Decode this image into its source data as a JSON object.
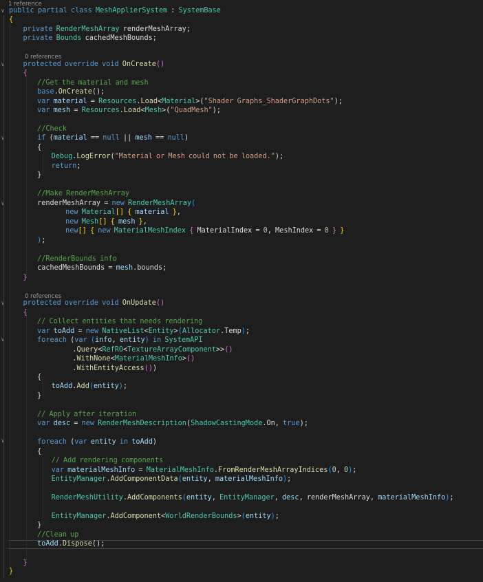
{
  "editor": {
    "theme_colors": {
      "background": "#1e1e1e",
      "keyword": "#569cd6",
      "type": "#4ec9b0",
      "string": "#d69d85",
      "comment": "#57a64a",
      "number": "#b5cea8",
      "method": "#dcdcaa",
      "local": "#9cdcfe",
      "default": "#dcdcdc",
      "brace_lvl1": "#ffd700",
      "brace_lvl2": "#da70d6",
      "brace_lvl3": "#179fff",
      "codelens": "#999999"
    },
    "codelens": {
      "class_refs": "1 reference",
      "oncreate_refs": "0 references",
      "onupdate_refs": "0 references"
    },
    "lines": [
      [
        [
          "kw",
          "public"
        ],
        [
          "d",
          " "
        ],
        [
          "kw",
          "partial"
        ],
        [
          "d",
          " "
        ],
        [
          "kw",
          "class"
        ],
        [
          "d",
          " "
        ],
        [
          "ty",
          "MeshApplierSystem"
        ],
        [
          "d",
          " : "
        ],
        [
          "ty",
          "SystemBase"
        ]
      ],
      [
        [
          "b1",
          "{"
        ]
      ],
      [
        [
          "d",
          "    "
        ],
        [
          "kw",
          "private"
        ],
        [
          "d",
          " "
        ],
        [
          "ty",
          "RenderMeshArray"
        ],
        [
          "d",
          " renderMeshArray;"
        ]
      ],
      [
        [
          "d",
          "    "
        ],
        [
          "kw",
          "private"
        ],
        [
          "d",
          " "
        ],
        [
          "ty",
          "Bounds"
        ],
        [
          "d",
          " cachedMeshBounds;"
        ]
      ],
      [],
      [
        [
          "d",
          "    "
        ],
        [
          "kw",
          "protected"
        ],
        [
          "d",
          " "
        ],
        [
          "kw",
          "override"
        ],
        [
          "d",
          " "
        ],
        [
          "kw",
          "void"
        ],
        [
          "d",
          " "
        ],
        [
          "fn",
          "OnCreate"
        ],
        [
          "b2",
          "()"
        ]
      ],
      [
        [
          "d",
          "    "
        ],
        [
          "b2",
          "{"
        ]
      ],
      [
        [
          "d",
          "        "
        ],
        [
          "cm",
          "//Get the material and mesh"
        ]
      ],
      [
        [
          "d",
          "        "
        ],
        [
          "kw",
          "base"
        ],
        [
          "d",
          "."
        ],
        [
          "fn",
          "OnCreate"
        ],
        [
          "d",
          "();"
        ]
      ],
      [
        [
          "d",
          "        "
        ],
        [
          "kw",
          "var"
        ],
        [
          "d",
          " "
        ],
        [
          "lv",
          "material"
        ],
        [
          "d",
          " = "
        ],
        [
          "ty",
          "Resources"
        ],
        [
          "d",
          "."
        ],
        [
          "fn",
          "Load"
        ],
        [
          "d",
          "<"
        ],
        [
          "ty",
          "Material"
        ],
        [
          "d",
          ">("
        ],
        [
          "st",
          "\"Shader Graphs_ShaderGraphDots\""
        ],
        [
          "d",
          ");"
        ]
      ],
      [
        [
          "d",
          "        "
        ],
        [
          "kw",
          "var"
        ],
        [
          "d",
          " "
        ],
        [
          "lv",
          "mesh"
        ],
        [
          "d",
          " = "
        ],
        [
          "ty",
          "Resources"
        ],
        [
          "d",
          "."
        ],
        [
          "fn",
          "Load"
        ],
        [
          "d",
          "<"
        ],
        [
          "ty",
          "Mesh"
        ],
        [
          "d",
          ">("
        ],
        [
          "st",
          "\"QuadMesh\""
        ],
        [
          "d",
          ");"
        ]
      ],
      [],
      [
        [
          "d",
          "        "
        ],
        [
          "cm",
          "//Check"
        ]
      ],
      [
        [
          "d",
          "        "
        ],
        [
          "kw",
          "if"
        ],
        [
          "d",
          " ("
        ],
        [
          "lv",
          "material"
        ],
        [
          "d",
          " == "
        ],
        [
          "kw",
          "null"
        ],
        [
          "d",
          " || "
        ],
        [
          "lv",
          "mesh"
        ],
        [
          "d",
          " == "
        ],
        [
          "kw",
          "null"
        ],
        [
          "d",
          ")"
        ]
      ],
      [
        [
          "d",
          "        {"
        ]
      ],
      [
        [
          "d",
          "            "
        ],
        [
          "ty",
          "Debug"
        ],
        [
          "d",
          "."
        ],
        [
          "fn",
          "LogError"
        ],
        [
          "d",
          "("
        ],
        [
          "st",
          "\"Material or Mesh could not be loaded.\""
        ],
        [
          "d",
          ");"
        ]
      ],
      [
        [
          "d",
          "            "
        ],
        [
          "kw",
          "return"
        ],
        [
          "d",
          ";"
        ]
      ],
      [
        [
          "d",
          "        }"
        ]
      ],
      [],
      [
        [
          "d",
          "        "
        ],
        [
          "cm",
          "//Make RenderMeshArray"
        ]
      ],
      [
        [
          "d",
          "        renderMeshArray = "
        ],
        [
          "kw",
          "new"
        ],
        [
          "d",
          " "
        ],
        [
          "ty",
          "RenderMeshArray"
        ],
        [
          "b3",
          "("
        ]
      ],
      [
        [
          "d",
          "                "
        ],
        [
          "kw",
          "new"
        ],
        [
          "d",
          " "
        ],
        [
          "ty",
          "Material"
        ],
        [
          "b1",
          "[]"
        ],
        [
          "d",
          " "
        ],
        [
          "b1",
          "{"
        ],
        [
          "d",
          " "
        ],
        [
          "lv",
          "material"
        ],
        [
          "d",
          " "
        ],
        [
          "b1",
          "}"
        ],
        [
          "d",
          ","
        ]
      ],
      [
        [
          "d",
          "                "
        ],
        [
          "kw",
          "new"
        ],
        [
          "d",
          " "
        ],
        [
          "ty",
          "Mesh"
        ],
        [
          "b1",
          "[]"
        ],
        [
          "d",
          " "
        ],
        [
          "b1",
          "{"
        ],
        [
          "d",
          " "
        ],
        [
          "lv",
          "mesh"
        ],
        [
          "d",
          " "
        ],
        [
          "b1",
          "}"
        ],
        [
          "d",
          ","
        ]
      ],
      [
        [
          "d",
          "                "
        ],
        [
          "kw",
          "new"
        ],
        [
          "b1",
          "[]"
        ],
        [
          "d",
          " "
        ],
        [
          "b1",
          "{"
        ],
        [
          "d",
          " "
        ],
        [
          "kw",
          "new"
        ],
        [
          "d",
          " "
        ],
        [
          "ty",
          "MaterialMeshIndex"
        ],
        [
          "d",
          " "
        ],
        [
          "b2",
          "{"
        ],
        [
          "d",
          " MaterialIndex = "
        ],
        [
          "nm",
          "0"
        ],
        [
          "d",
          ", MeshIndex = "
        ],
        [
          "nm",
          "0"
        ],
        [
          "d",
          " "
        ],
        [
          "b2",
          "}"
        ],
        [
          "d",
          " "
        ],
        [
          "b1",
          "}"
        ]
      ],
      [
        [
          "d",
          "        "
        ],
        [
          "b3",
          ")"
        ],
        [
          "d",
          ";"
        ]
      ],
      [],
      [
        [
          "d",
          "        "
        ],
        [
          "cm",
          "//RenderBounds info"
        ]
      ],
      [
        [
          "d",
          "        cachedMeshBounds = "
        ],
        [
          "lv",
          "mesh"
        ],
        [
          "d",
          "."
        ],
        [
          "d",
          "bounds;"
        ]
      ],
      [
        [
          "d",
          "    "
        ],
        [
          "b2",
          "}"
        ]
      ],
      [],
      [
        [
          "d",
          "    "
        ],
        [
          "kw",
          "protected"
        ],
        [
          "d",
          " "
        ],
        [
          "kw",
          "override"
        ],
        [
          "d",
          " "
        ],
        [
          "kw",
          "void"
        ],
        [
          "d",
          " "
        ],
        [
          "fn",
          "OnUpdate"
        ],
        [
          "b2",
          "()"
        ]
      ],
      [
        [
          "d",
          "    "
        ],
        [
          "b2",
          "{"
        ]
      ],
      [
        [
          "d",
          "        "
        ],
        [
          "cm",
          "// Collect entities that needs rendering"
        ]
      ],
      [
        [
          "d",
          "        "
        ],
        [
          "kw",
          "var"
        ],
        [
          "d",
          " "
        ],
        [
          "lv",
          "toAdd"
        ],
        [
          "d",
          " = "
        ],
        [
          "kw",
          "new"
        ],
        [
          "d",
          " "
        ],
        [
          "ty",
          "NativeList"
        ],
        [
          "d",
          "<"
        ],
        [
          "ty",
          "Entity"
        ],
        [
          "d",
          ">"
        ],
        [
          "b3",
          "("
        ],
        [
          "ty",
          "Allocator"
        ],
        [
          "d",
          ".Temp"
        ],
        [
          "b3",
          ")"
        ],
        [
          "d",
          ";"
        ]
      ],
      [
        [
          "d",
          "        "
        ],
        [
          "kw",
          "foreach"
        ],
        [
          "d",
          " ("
        ],
        [
          "kw",
          "var"
        ],
        [
          "d",
          " "
        ],
        [
          "b3",
          "("
        ],
        [
          "lv",
          "info"
        ],
        [
          "d",
          ", "
        ],
        [
          "lv",
          "entity"
        ],
        [
          "b3",
          ")"
        ],
        [
          "d",
          " "
        ],
        [
          "kw",
          "in"
        ],
        [
          "d",
          " "
        ],
        [
          "ty",
          "SystemAPI"
        ]
      ],
      [
        [
          "d",
          "                  ."
        ],
        [
          "fn",
          "Query"
        ],
        [
          "d",
          "<"
        ],
        [
          "ty",
          "RefRO"
        ],
        [
          "d",
          "<"
        ],
        [
          "ty",
          "TextureArrayComponent"
        ],
        [
          "d",
          ">>"
        ],
        [
          "b2",
          "()"
        ]
      ],
      [
        [
          "d",
          "                  ."
        ],
        [
          "fn",
          "WithNone"
        ],
        [
          "d",
          "<"
        ],
        [
          "ty",
          "MaterialMeshInfo"
        ],
        [
          "d",
          ">"
        ],
        [
          "b2",
          "()"
        ]
      ],
      [
        [
          "d",
          "                  ."
        ],
        [
          "fn",
          "WithEntityAccess"
        ],
        [
          "b2",
          "()"
        ],
        [
          "d",
          ")"
        ]
      ],
      [
        [
          "d",
          "        {"
        ]
      ],
      [
        [
          "d",
          "            "
        ],
        [
          "lv",
          "toAdd"
        ],
        [
          "d",
          "."
        ],
        [
          "fn",
          "Add"
        ],
        [
          "b3",
          "("
        ],
        [
          "lv",
          "entity"
        ],
        [
          "b3",
          ")"
        ],
        [
          "d",
          ";"
        ]
      ],
      [
        [
          "d",
          "        }"
        ]
      ],
      [],
      [
        [
          "d",
          "        "
        ],
        [
          "cm",
          "// Apply after iteration"
        ]
      ],
      [
        [
          "d",
          "        "
        ],
        [
          "kw",
          "var"
        ],
        [
          "d",
          " "
        ],
        [
          "lv",
          "desc"
        ],
        [
          "d",
          " = "
        ],
        [
          "kw",
          "new"
        ],
        [
          "d",
          " "
        ],
        [
          "ty",
          "RenderMeshDescription"
        ],
        [
          "d",
          "("
        ],
        [
          "ty",
          "ShadowCastingMode"
        ],
        [
          "d",
          ".On, "
        ],
        [
          "kw",
          "true"
        ],
        [
          "d",
          ");"
        ]
      ],
      [],
      [
        [
          "d",
          "        "
        ],
        [
          "kw",
          "foreach"
        ],
        [
          "d",
          " ("
        ],
        [
          "kw",
          "var"
        ],
        [
          "d",
          " "
        ],
        [
          "lv",
          "entity"
        ],
        [
          "d",
          " "
        ],
        [
          "kw",
          "in"
        ],
        [
          "d",
          " "
        ],
        [
          "lv",
          "toAdd"
        ],
        [
          "d",
          ")"
        ]
      ],
      [
        [
          "d",
          "        {"
        ]
      ],
      [
        [
          "d",
          "            "
        ],
        [
          "cm",
          "// Add rendering components"
        ]
      ],
      [
        [
          "d",
          "            "
        ],
        [
          "kw",
          "var"
        ],
        [
          "d",
          " "
        ],
        [
          "lv",
          "materialMeshInfo"
        ],
        [
          "d",
          " = "
        ],
        [
          "ty",
          "MaterialMeshInfo"
        ],
        [
          "d",
          "."
        ],
        [
          "fn",
          "FromRenderMeshArrayIndices"
        ],
        [
          "b3",
          "("
        ],
        [
          "nm",
          "0"
        ],
        [
          "d",
          ", "
        ],
        [
          "nm",
          "0"
        ],
        [
          "b3",
          ")"
        ],
        [
          "d",
          ";"
        ]
      ],
      [
        [
          "d",
          "            "
        ],
        [
          "ty",
          "EntityManager"
        ],
        [
          "d",
          "."
        ],
        [
          "fn",
          "AddComponentData"
        ],
        [
          "b3",
          "("
        ],
        [
          "lv",
          "entity"
        ],
        [
          "d",
          ", "
        ],
        [
          "lv",
          "materialMeshInfo"
        ],
        [
          "b3",
          ")"
        ],
        [
          "d",
          ";"
        ]
      ],
      [],
      [
        [
          "d",
          "            "
        ],
        [
          "ty",
          "RenderMeshUtility"
        ],
        [
          "d",
          "."
        ],
        [
          "fn",
          "AddComponents"
        ],
        [
          "b3",
          "("
        ],
        [
          "lv",
          "entity"
        ],
        [
          "d",
          ", "
        ],
        [
          "ty",
          "EntityManager"
        ],
        [
          "d",
          ", "
        ],
        [
          "lv",
          "desc"
        ],
        [
          "d",
          ", renderMeshArray, "
        ],
        [
          "lv",
          "materialMeshInfo"
        ],
        [
          "b3",
          ")"
        ],
        [
          "d",
          ";"
        ]
      ],
      [],
      [
        [
          "d",
          "            "
        ],
        [
          "ty",
          "EntityManager"
        ],
        [
          "d",
          "."
        ],
        [
          "fn",
          "AddComponent"
        ],
        [
          "d",
          "<"
        ],
        [
          "ty",
          "WorldRenderBounds"
        ],
        [
          "d",
          ">"
        ],
        [
          "b3",
          "("
        ],
        [
          "lv",
          "entity"
        ],
        [
          "b3",
          ")"
        ],
        [
          "d",
          ";"
        ]
      ],
      [
        [
          "d",
          "        }"
        ]
      ],
      [
        [
          "d",
          "        "
        ],
        [
          "cm",
          "//Clean up"
        ]
      ],
      [
        [
          "d",
          "        "
        ],
        [
          "lv",
          "toAdd"
        ],
        [
          "d",
          "."
        ],
        [
          "fn",
          "Dispose"
        ],
        [
          "d",
          "();"
        ]
      ],
      [],
      [
        [
          "d",
          "    "
        ],
        [
          "b2",
          "}"
        ]
      ],
      [
        [
          "b1",
          "}"
        ]
      ]
    ]
  }
}
